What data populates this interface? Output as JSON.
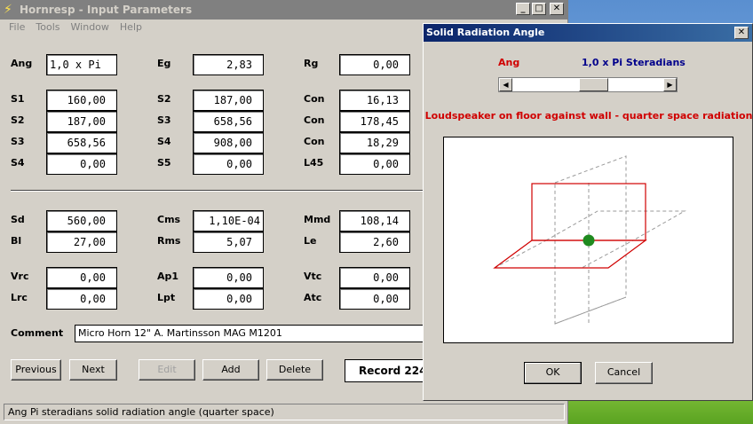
{
  "main_window": {
    "title": "Hornresp - Input Parameters",
    "menu": [
      "File",
      "Tools",
      "Window",
      "Help"
    ],
    "params": {
      "ang": {
        "label": "Ang",
        "value": "1,0 x Pi"
      },
      "eg": {
        "label": "Eg",
        "value": "2,83"
      },
      "rg": {
        "label": "Rg",
        "value": "0,00"
      },
      "s1a": {
        "label": "S1",
        "value": "160,00"
      },
      "s2a": {
        "label": "S2",
        "value": "187,00"
      },
      "con1": {
        "label": "Con",
        "value": "16,13"
      },
      "s2b": {
        "label": "S2",
        "value": "187,00"
      },
      "s3a": {
        "label": "S3",
        "value": "658,56"
      },
      "con2": {
        "label": "Con",
        "value": "178,45"
      },
      "s3b": {
        "label": "S3",
        "value": "658,56"
      },
      "s4a": {
        "label": "S4",
        "value": "908,00"
      },
      "con3": {
        "label": "Con",
        "value": "18,29"
      },
      "s4b": {
        "label": "S4",
        "value": "0,00"
      },
      "s5": {
        "label": "S5",
        "value": "0,00"
      },
      "l45": {
        "label": "L45",
        "value": "0,00"
      },
      "sd": {
        "label": "Sd",
        "value": "560,00"
      },
      "cms": {
        "label": "Cms",
        "value": "1,10E-04"
      },
      "mmd": {
        "label": "Mmd",
        "value": "108,14"
      },
      "bl": {
        "label": "Bl",
        "value": "27,00"
      },
      "rms": {
        "label": "Rms",
        "value": "5,07"
      },
      "le": {
        "label": "Le",
        "value": "2,60"
      },
      "vrc": {
        "label": "Vrc",
        "value": "0,00"
      },
      "ap1": {
        "label": "Ap1",
        "value": "0,00"
      },
      "vtc": {
        "label": "Vtc",
        "value": "0,00"
      },
      "lrc": {
        "label": "Lrc",
        "value": "0,00"
      },
      "lpt": {
        "label": "Lpt",
        "value": "0,00"
      },
      "atc": {
        "label": "Atc",
        "value": "0,00"
      }
    },
    "comment": {
      "label": "Comment",
      "value": "Micro Horn 12\" A. Martinsson MAG M1201"
    },
    "buttons": {
      "previous": "Previous",
      "next": "Next",
      "edit": "Edit",
      "add": "Add",
      "delete": "Delete"
    },
    "record": "Record 224",
    "status": "Ang   Pi steradians solid radiation angle  (quarter space)"
  },
  "dialog": {
    "title": "Solid Radiation Angle",
    "ang_label": "Ang",
    "ang_value": "1,0 x Pi Steradians",
    "slider_fraction": 0.55,
    "description": "Loudspeaker on floor against wall - quarter space radiation",
    "ok": "OK",
    "cancel": "Cancel"
  },
  "colors": {
    "red": "#d00000",
    "blue": "#00008b",
    "green_dot": "#1f8a1f"
  }
}
